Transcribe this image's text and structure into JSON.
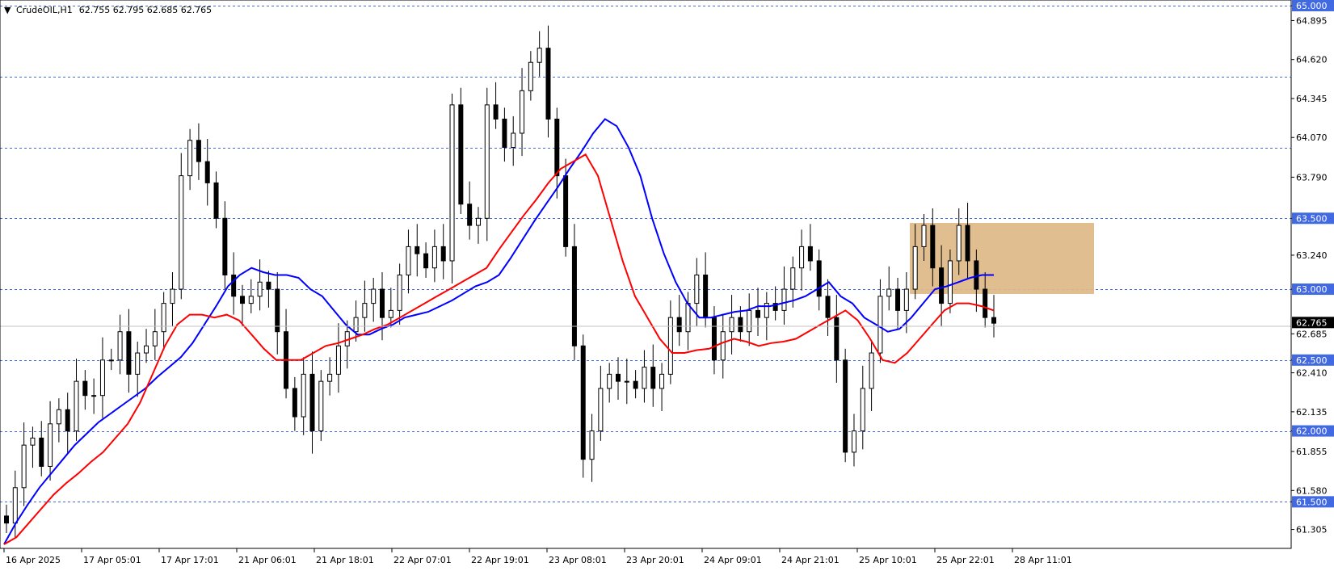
{
  "header": {
    "menu_arrow": "▼",
    "symbol": "CrudeOIL,H1",
    "ohlc": "62.755 62.795 62.685 62.765"
  },
  "chart_data": {
    "type": "candlestick",
    "ylim": [
      61.2,
      65.03
    ],
    "y_ticks": [
      "65.000",
      "64.895",
      "64.620",
      "64.345",
      "64.070",
      "63.790",
      "63.500",
      "63.240",
      "63.000",
      "62.685",
      "62.500",
      "62.410",
      "62.135",
      "62.000",
      "61.855",
      "61.580",
      "61.500",
      "61.305"
    ],
    "level_lines": [
      "65.000",
      "64.500",
      "64.000",
      "63.500",
      "63.000",
      "62.500",
      "62.000",
      "61.500"
    ],
    "current_price": "62.765",
    "x_tick_labels": [
      "16 Apr 2025",
      "17 Apr 05:01",
      "17 Apr 17:01",
      "21 Apr 06:01",
      "21 Apr 18:01",
      "22 Apr 07:01",
      "22 Apr 19:01",
      "23 Apr 08:01",
      "23 Apr 20:01",
      "24 Apr 09:01",
      "24 Apr 21:01",
      "25 Apr 10:01",
      "25 Apr 22:01",
      "28 Apr 11:01"
    ],
    "closes": [
      61.35,
      61.6,
      61.9,
      61.95,
      61.75,
      62.05,
      62.15,
      62.0,
      62.35,
      62.25,
      62.25,
      62.5,
      62.5,
      62.7,
      62.4,
      62.55,
      62.6,
      62.7,
      62.9,
      63.0,
      63.8,
      64.05,
      63.9,
      63.75,
      63.5,
      63.1,
      62.95,
      62.9,
      62.95,
      63.05,
      63.0,
      62.7,
      62.3,
      62.1,
      62.4,
      62.0,
      62.35,
      62.4,
      62.6,
      62.7,
      62.8,
      62.9,
      63.0,
      62.8,
      62.85,
      63.1,
      63.3,
      63.25,
      63.15,
      63.3,
      63.2,
      64.3,
      63.6,
      63.45,
      63.5,
      64.3,
      64.2,
      64.0,
      64.1,
      64.4,
      64.6,
      64.7,
      64.2,
      63.8,
      63.3,
      62.6,
      61.8,
      62.0,
      62.3,
      62.4,
      62.35,
      62.35,
      62.3,
      62.45,
      62.3,
      62.4,
      62.8,
      62.7,
      62.9,
      63.1,
      62.8,
      62.5,
      62.7,
      62.8,
      62.7,
      62.85,
      62.8,
      62.9,
      62.85,
      63.0,
      63.15,
      63.3,
      63.2,
      62.95,
      62.8,
      62.5,
      61.85,
      62.0,
      62.3,
      62.55,
      62.95,
      63.0,
      62.85,
      63.0,
      63.3,
      63.45,
      63.15,
      62.9,
      63.2,
      63.45,
      63.2,
      63.0,
      62.8,
      62.76
    ],
    "series": [
      {
        "name": "",
        "color": "#0000ff",
        "values": [
          61.2,
          61.35,
          61.48,
          61.6,
          61.7,
          61.8,
          61.9,
          61.98,
          62.06,
          62.12,
          62.18,
          62.24,
          62.3,
          62.38,
          62.45,
          62.52,
          62.62,
          62.75,
          62.88,
          63.02,
          63.1,
          63.15,
          63.12,
          63.1,
          63.1,
          63.08,
          63.0,
          62.95,
          62.85,
          62.75,
          62.68,
          62.68,
          62.72,
          62.75,
          62.8,
          62.82,
          62.84,
          62.88,
          62.92,
          62.97,
          63.02,
          63.05,
          63.1,
          63.22,
          63.35,
          63.48,
          63.6,
          63.72,
          63.85,
          63.97,
          64.1,
          64.2,
          64.15,
          64.0,
          63.8,
          63.5,
          63.25,
          63.05,
          62.9,
          62.8,
          62.8,
          62.82,
          62.84,
          62.85,
          62.88,
          62.88,
          62.9,
          62.92,
          62.95,
          63.0,
          63.05,
          62.95,
          62.9,
          62.8,
          62.75,
          62.7,
          62.72,
          62.8,
          62.9,
          63.0,
          63.02,
          63.05,
          63.08,
          63.1,
          63.1
        ]
      },
      {
        "name": "",
        "color": "#ff0000",
        "values": [
          61.2,
          61.25,
          61.35,
          61.45,
          61.55,
          61.63,
          61.7,
          61.78,
          61.85,
          61.95,
          62.05,
          62.2,
          62.4,
          62.6,
          62.75,
          62.82,
          62.82,
          62.8,
          62.82,
          62.78,
          62.68,
          62.58,
          62.5,
          62.5,
          62.5,
          62.55,
          62.6,
          62.62,
          62.65,
          62.68,
          62.72,
          62.75,
          62.8,
          62.85,
          62.9,
          62.95,
          63.0,
          63.05,
          63.1,
          63.15,
          63.28,
          63.4,
          63.52,
          63.63,
          63.75,
          63.85,
          63.9,
          63.95,
          63.8,
          63.5,
          63.2,
          62.95,
          62.8,
          62.65,
          62.55,
          62.55,
          62.57,
          62.58,
          62.62,
          62.65,
          62.63,
          62.6,
          62.62,
          62.63,
          62.65,
          62.7,
          62.75,
          62.8,
          62.85,
          62.78,
          62.65,
          62.5,
          62.48,
          62.55,
          62.65,
          62.75,
          62.85,
          62.9,
          62.9,
          62.88,
          62.85
        ]
      }
    ]
  }
}
